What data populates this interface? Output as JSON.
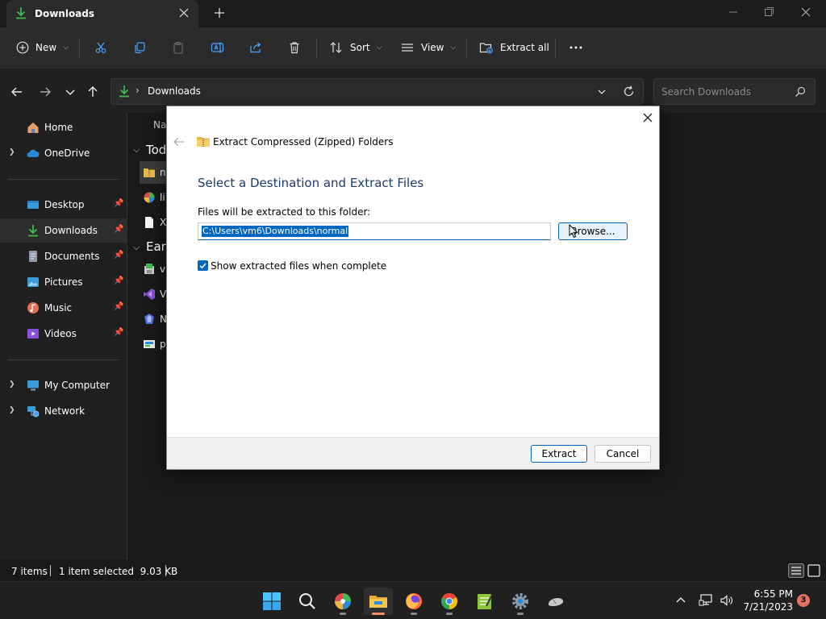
{
  "window": {
    "tab_title": "Downloads",
    "tab_icon": "download-arrow-icon"
  },
  "toolbar": {
    "new_label": "New",
    "sort_label": "Sort",
    "view_label": "View",
    "extract_all_label": "Extract all",
    "more_icon": "ellipsis-icon"
  },
  "address": {
    "location": "Downloads",
    "search_placeholder": "Search Downloads"
  },
  "sidebar": {
    "items": [
      {
        "label": "Home",
        "icon": "home-icon"
      },
      {
        "label": "OneDrive",
        "icon": "cloud-icon"
      },
      {
        "label": "Desktop",
        "icon": "desktop-icon"
      },
      {
        "label": "Downloads",
        "icon": "download-icon"
      },
      {
        "label": "Documents",
        "icon": "documents-icon"
      },
      {
        "label": "Pictures",
        "icon": "pictures-icon"
      },
      {
        "label": "Music",
        "icon": "music-icon"
      },
      {
        "label": "Videos",
        "icon": "videos-icon"
      },
      {
        "label": "My Computer",
        "icon": "computer-icon"
      },
      {
        "label": "Network",
        "icon": "network-icon"
      }
    ]
  },
  "filelist": {
    "column_name": "Na",
    "group_today": "Tod",
    "group_earlier": "Earl",
    "files": [
      {
        "name": "n",
        "icon": "zip-folder-icon"
      },
      {
        "name": "li",
        "icon": "color-wheel-icon"
      },
      {
        "name": "X",
        "icon": "file-icon"
      },
      {
        "name": "v",
        "icon": "installer-icon"
      },
      {
        "name": "V",
        "icon": "visual-studio-icon"
      },
      {
        "name": "N",
        "icon": "node-icon"
      },
      {
        "name": "p",
        "icon": "package-icon"
      }
    ]
  },
  "status": {
    "items_count": "7 items",
    "selection": "1 item selected  9.03 KB"
  },
  "dialog": {
    "title": "Extract Compressed (Zipped) Folders",
    "heading": "Select a Destination and Extract Files",
    "label": "Files will be extracted to this folder:",
    "destination": "C:\\Users\\vm6\\Downloads\\normal",
    "browse_label": "Browse...",
    "checkbox_label": "Show extracted files when complete",
    "checkbox_checked": true,
    "extract_label": "Extract",
    "cancel_label": "Cancel"
  },
  "taskbar": {
    "time": "6:55 PM",
    "date": "7/21/2023",
    "notifications": "3"
  },
  "colors": {
    "accent": "#0067c0",
    "heading": "#1e3a6b",
    "download_green": "#3fb950"
  }
}
